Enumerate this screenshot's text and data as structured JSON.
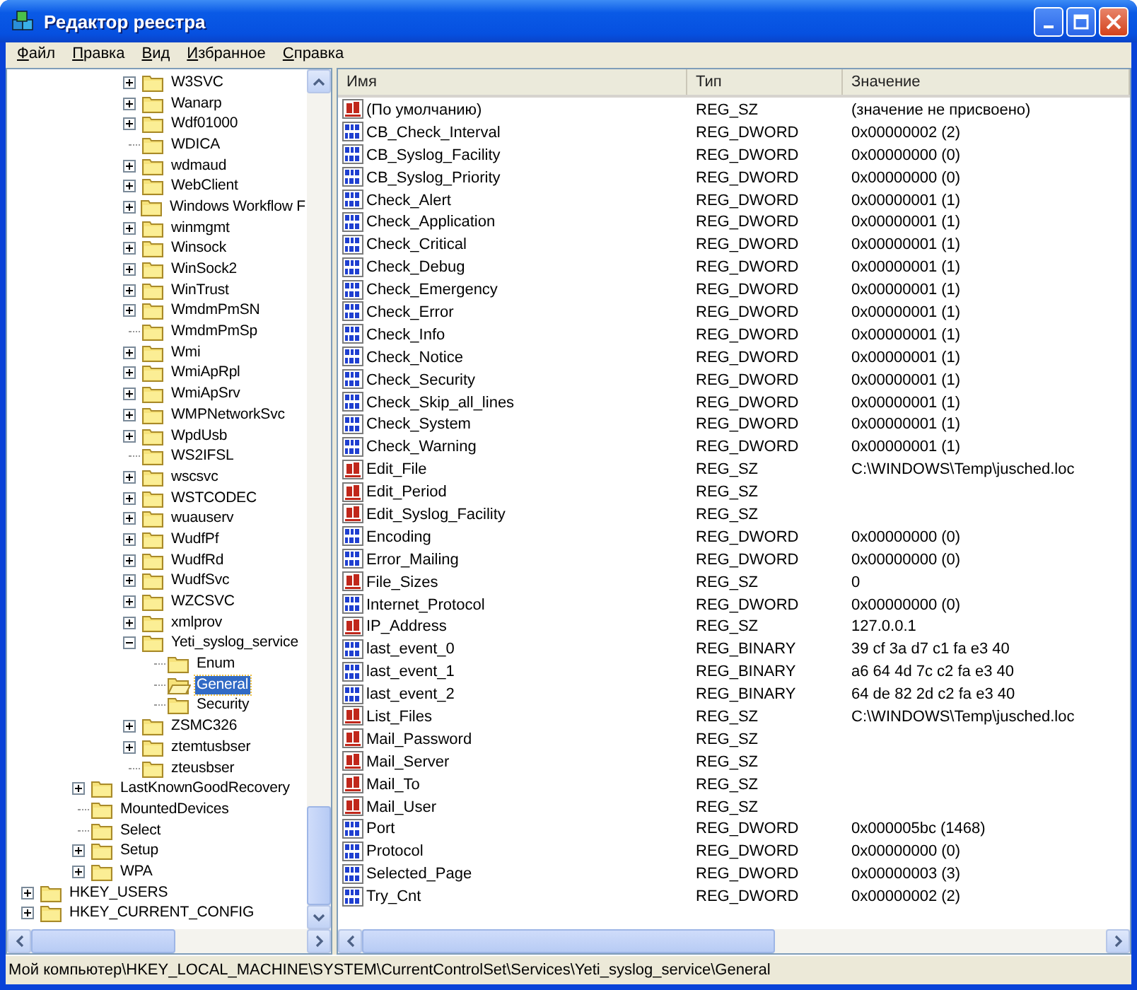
{
  "window": {
    "title": "Редактор реестра"
  },
  "menu": [
    "Файл",
    "Правка",
    "Вид",
    "Избранное",
    "Справка"
  ],
  "tree": {
    "items": [
      {
        "children": [
          {
            "children": [
              {
                "children": [
                  {
                    "children": [
                      {
                        "label": "W3SVC",
                        "kind": "collapsed",
                        "selected": false
                      },
                      {
                        "label": "Wanarp",
                        "kind": "collapsed",
                        "selected": false
                      },
                      {
                        "label": "Wdf01000",
                        "kind": "collapsed",
                        "selected": false
                      },
                      {
                        "label": "WDICA",
                        "kind": "leaf",
                        "selected": false
                      },
                      {
                        "label": "wdmaud",
                        "kind": "collapsed",
                        "selected": false
                      },
                      {
                        "label": "WebClient",
                        "kind": "collapsed",
                        "selected": false
                      },
                      {
                        "label": "Windows Workflow F",
                        "kind": "collapsed",
                        "selected": false
                      },
                      {
                        "label": "winmgmt",
                        "kind": "collapsed",
                        "selected": false
                      },
                      {
                        "label": "Winsock",
                        "kind": "collapsed",
                        "selected": false
                      },
                      {
                        "label": "WinSock2",
                        "kind": "collapsed",
                        "selected": false
                      },
                      {
                        "label": "WinTrust",
                        "kind": "collapsed",
                        "selected": false
                      },
                      {
                        "label": "WmdmPmSN",
                        "kind": "collapsed",
                        "selected": false
                      },
                      {
                        "label": "WmdmPmSp",
                        "kind": "leaf",
                        "selected": false
                      },
                      {
                        "label": "Wmi",
                        "kind": "collapsed",
                        "selected": false
                      },
                      {
                        "label": "WmiApRpl",
                        "kind": "collapsed",
                        "selected": false
                      },
                      {
                        "label": "WmiApSrv",
                        "kind": "collapsed",
                        "selected": false
                      },
                      {
                        "label": "WMPNetworkSvc",
                        "kind": "collapsed",
                        "selected": false
                      },
                      {
                        "label": "WpdUsb",
                        "kind": "collapsed",
                        "selected": false
                      },
                      {
                        "label": "WS2IFSL",
                        "kind": "leaf",
                        "selected": false
                      },
                      {
                        "label": "wscsvc",
                        "kind": "collapsed",
                        "selected": false
                      },
                      {
                        "label": "WSTCODEC",
                        "kind": "collapsed",
                        "selected": false
                      },
                      {
                        "label": "wuauserv",
                        "kind": "collapsed",
                        "selected": false
                      },
                      {
                        "label": "WudfPf",
                        "kind": "collapsed",
                        "selected": false
                      },
                      {
                        "label": "WudfRd",
                        "kind": "collapsed",
                        "selected": false
                      },
                      {
                        "label": "WudfSvc",
                        "kind": "collapsed",
                        "selected": false
                      },
                      {
                        "label": "WZCSVC",
                        "kind": "collapsed",
                        "selected": false
                      },
                      {
                        "label": "xmlprov",
                        "kind": "collapsed",
                        "selected": false
                      },
                      {
                        "label": "Yeti_syslog_service",
                        "kind": "expanded",
                        "selected": false,
                        "children": [
                          {
                            "label": "Enum",
                            "kind": "leaf",
                            "selected": false
                          },
                          {
                            "label": "General",
                            "kind": "leaf",
                            "selected": true
                          },
                          {
                            "label": "Security",
                            "kind": "leaf",
                            "selected": false
                          }
                        ]
                      },
                      {
                        "label": "ZSMC326",
                        "kind": "collapsed",
                        "selected": false
                      },
                      {
                        "label": "ztemtusbser",
                        "kind": "collapsed",
                        "selected": false
                      },
                      {
                        "label": "zteusbser",
                        "kind": "leaf",
                        "selected": false
                      }
                    ]
                  }
                ]
              },
              {
                "label": "LastKnownGoodRecovery",
                "kind": "collapsed",
                "selected": false
              },
              {
                "label": "MountedDevices",
                "kind": "leaf",
                "selected": false
              },
              {
                "label": "Select",
                "kind": "leaf",
                "selected": false
              },
              {
                "label": "Setup",
                "kind": "collapsed",
                "selected": false
              },
              {
                "label": "WPA",
                "kind": "collapsed",
                "selected": false
              }
            ]
          }
        ]
      },
      {
        "label": "HKEY_USERS",
        "kind": "collapsed",
        "selected": false
      },
      {
        "label": "HKEY_CURRENT_CONFIG",
        "kind": "collapsed",
        "selected": false
      }
    ]
  },
  "table": {
    "columns": [
      "Имя",
      "Тип",
      "Значение"
    ],
    "rows": [
      {
        "kind": "string",
        "name": "(По умолчанию)",
        "type": "REG_SZ",
        "value": "(значение не присвоено)"
      },
      {
        "kind": "binary",
        "name": "CB_Check_Interval",
        "type": "REG_DWORD",
        "value": "0x00000002 (2)"
      },
      {
        "kind": "binary",
        "name": "CB_Syslog_Facility",
        "type": "REG_DWORD",
        "value": "0x00000000 (0)"
      },
      {
        "kind": "binary",
        "name": "CB_Syslog_Priority",
        "type": "REG_DWORD",
        "value": "0x00000000 (0)"
      },
      {
        "kind": "binary",
        "name": "Check_Alert",
        "type": "REG_DWORD",
        "value": "0x00000001 (1)"
      },
      {
        "kind": "binary",
        "name": "Check_Application",
        "type": "REG_DWORD",
        "value": "0x00000001 (1)"
      },
      {
        "kind": "binary",
        "name": "Check_Critical",
        "type": "REG_DWORD",
        "value": "0x00000001 (1)"
      },
      {
        "kind": "binary",
        "name": "Check_Debug",
        "type": "REG_DWORD",
        "value": "0x00000001 (1)"
      },
      {
        "kind": "binary",
        "name": "Check_Emergency",
        "type": "REG_DWORD",
        "value": "0x00000001 (1)"
      },
      {
        "kind": "binary",
        "name": "Check_Error",
        "type": "REG_DWORD",
        "value": "0x00000001 (1)"
      },
      {
        "kind": "binary",
        "name": "Check_Info",
        "type": "REG_DWORD",
        "value": "0x00000001 (1)"
      },
      {
        "kind": "binary",
        "name": "Check_Notice",
        "type": "REG_DWORD",
        "value": "0x00000001 (1)"
      },
      {
        "kind": "binary",
        "name": "Check_Security",
        "type": "REG_DWORD",
        "value": "0x00000001 (1)"
      },
      {
        "kind": "binary",
        "name": "Check_Skip_all_lines",
        "type": "REG_DWORD",
        "value": "0x00000001 (1)"
      },
      {
        "kind": "binary",
        "name": "Check_System",
        "type": "REG_DWORD",
        "value": "0x00000001 (1)"
      },
      {
        "kind": "binary",
        "name": "Check_Warning",
        "type": "REG_DWORD",
        "value": "0x00000001 (1)"
      },
      {
        "kind": "string",
        "name": "Edit_File",
        "type": "REG_SZ",
        "value": "C:\\WINDOWS\\Temp\\jusched.loc"
      },
      {
        "kind": "string",
        "name": "Edit_Period",
        "type": "REG_SZ"
      },
      {
        "kind": "string",
        "name": "Edit_Syslog_Facility",
        "type": "REG_SZ"
      },
      {
        "kind": "binary",
        "name": "Encoding",
        "type": "REG_DWORD",
        "value": "0x00000000 (0)"
      },
      {
        "kind": "binary",
        "name": "Error_Mailing",
        "type": "REG_DWORD",
        "value": "0x00000000 (0)"
      },
      {
        "kind": "string",
        "name": "File_Sizes",
        "type": "REG_SZ",
        "value": "0"
      },
      {
        "kind": "binary",
        "name": "Internet_Protocol",
        "type": "REG_DWORD",
        "value": "0x00000000 (0)"
      },
      {
        "kind": "string",
        "name": "IP_Address",
        "type": "REG_SZ",
        "value": "127.0.0.1"
      },
      {
        "kind": "binary",
        "name": "last_event_0",
        "type": "REG_BINARY",
        "value": "39 cf 3a d7 c1 fa e3 40"
      },
      {
        "kind": "binary",
        "name": "last_event_1",
        "type": "REG_BINARY",
        "value": "a6 64 4d 7c c2 fa e3 40"
      },
      {
        "kind": "binary",
        "name": "last_event_2",
        "type": "REG_BINARY",
        "value": "64 de 82 2d c2 fa e3 40"
      },
      {
        "kind": "string",
        "name": "List_Files",
        "type": "REG_SZ",
        "value": "C:\\WINDOWS\\Temp\\jusched.loc"
      },
      {
        "kind": "string",
        "name": "Mail_Password",
        "type": "REG_SZ"
      },
      {
        "kind": "string",
        "name": "Mail_Server",
        "type": "REG_SZ"
      },
      {
        "kind": "string",
        "name": "Mail_To",
        "type": "REG_SZ"
      },
      {
        "kind": "string",
        "name": "Mail_User",
        "type": "REG_SZ"
      },
      {
        "kind": "binary",
        "name": "Port",
        "type": "REG_DWORD",
        "value": "0x000005bc (1468)"
      },
      {
        "kind": "binary",
        "name": "Protocol",
        "type": "REG_DWORD",
        "value": "0x00000000 (0)"
      },
      {
        "kind": "binary",
        "name": "Selected_Page",
        "type": "REG_DWORD",
        "value": "0x00000003 (3)"
      },
      {
        "kind": "binary",
        "name": "Try_Cnt",
        "type": "REG_DWORD",
        "value": "0x00000002 (2)"
      }
    ]
  },
  "status_bar": "Мой компьютер\\HKEY_LOCAL_MACHINE\\SYSTEM\\CurrentControlSet\\Services\\Yeti_syslog_service\\General"
}
